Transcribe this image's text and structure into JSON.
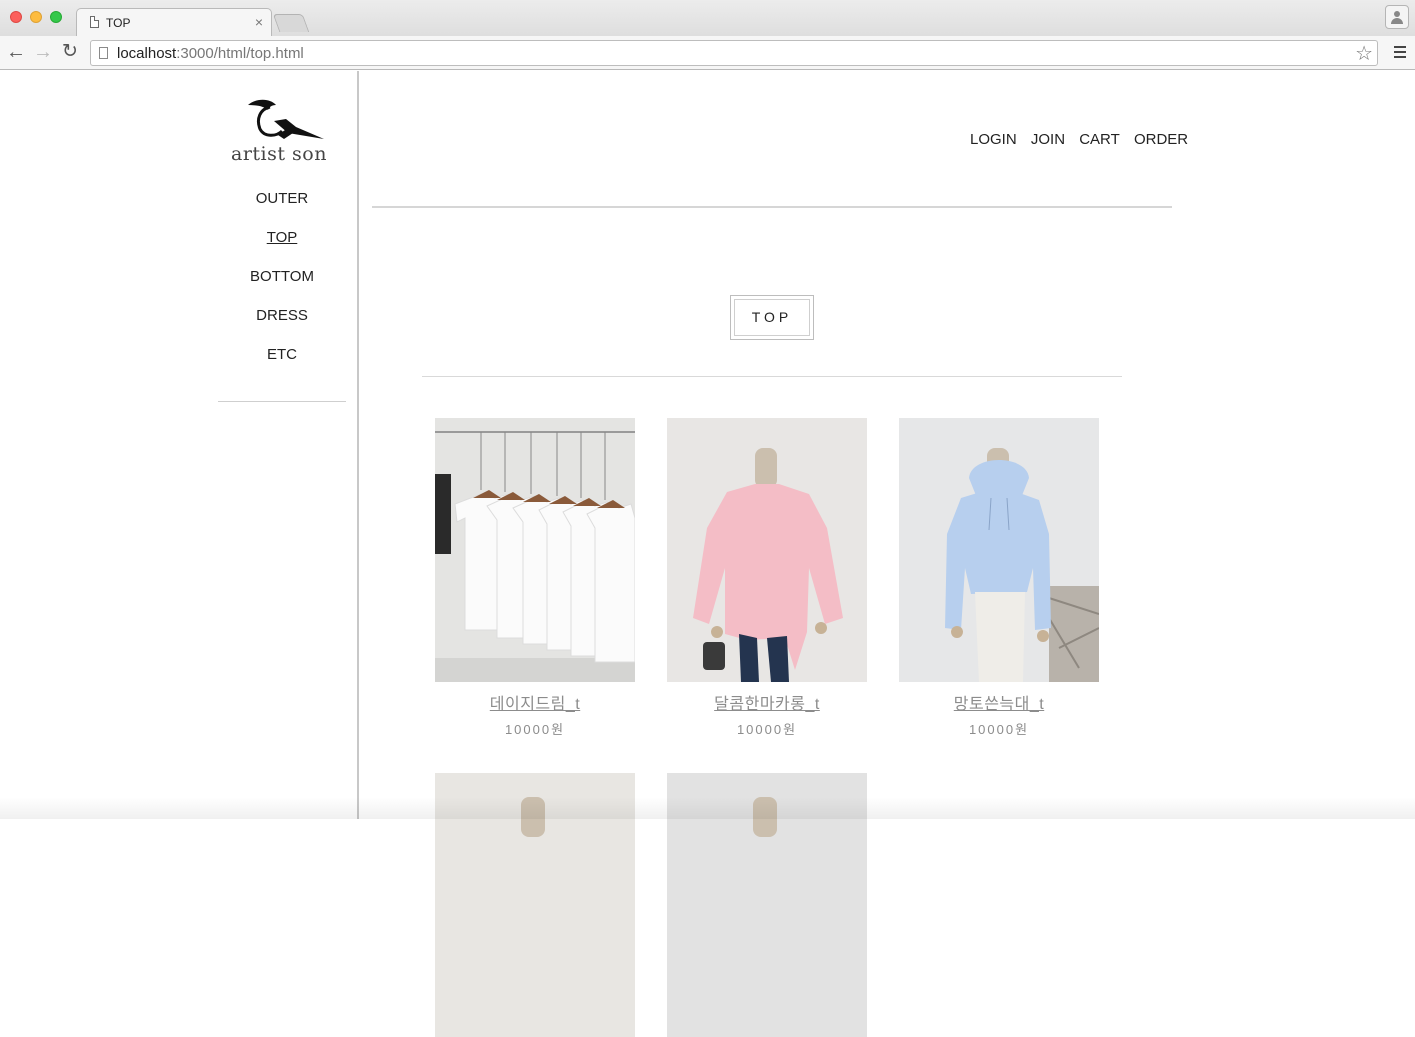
{
  "browser": {
    "tab_title": "TOP",
    "tab_close": "×",
    "url_host": "localhost",
    "url_path": ":3000/html/top.html"
  },
  "site": {
    "logo_text": "artist son"
  },
  "sidebar": {
    "items": [
      {
        "label": "OUTER"
      },
      {
        "label": "TOP"
      },
      {
        "label": "BOTTOM"
      },
      {
        "label": "DRESS"
      },
      {
        "label": "ETC"
      }
    ]
  },
  "header": {
    "menu": [
      {
        "label": "LOGIN"
      },
      {
        "label": "JOIN"
      },
      {
        "label": "CART"
      },
      {
        "label": "ORDER"
      }
    ]
  },
  "main": {
    "category_title": "TOP",
    "products": [
      {
        "name": "데이지드림_t",
        "price": "10000원"
      },
      {
        "name": "달콤한마카롱_t",
        "price": "10000원"
      },
      {
        "name": "망토쓴늑대_t",
        "price": "10000원"
      }
    ]
  },
  "colors": {
    "accent_text": "#8c8c8c",
    "divider": "#d6d6d6",
    "pink_sweater": "#f3bcc6",
    "blue_hoodie": "#b7cfee"
  }
}
